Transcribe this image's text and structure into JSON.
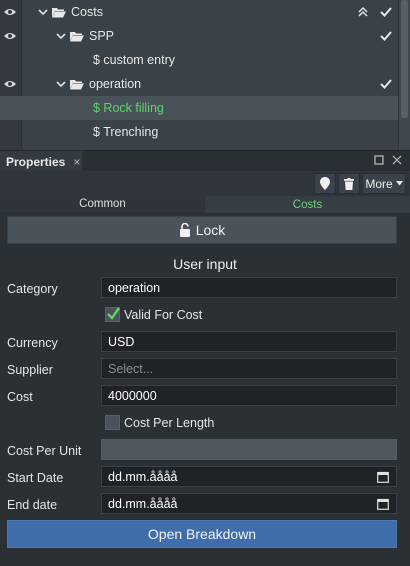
{
  "tree": {
    "rows": [
      {
        "label": "Costs",
        "kind": "folder",
        "expanded": true,
        "eye": true,
        "selected": false,
        "green": false
      },
      {
        "label": "SPP",
        "kind": "folder",
        "expanded": true,
        "eye": true,
        "selected": false,
        "green": false
      },
      {
        "label": "$ custom entry",
        "kind": "leaf",
        "eye": false,
        "selected": false,
        "green": false
      },
      {
        "label": "operation",
        "kind": "folder",
        "expanded": true,
        "eye": true,
        "selected": false,
        "green": false
      },
      {
        "label": "$ Rock filling",
        "kind": "leaf",
        "eye": false,
        "selected": true,
        "green": true
      },
      {
        "label": "$ Trenching",
        "kind": "leaf",
        "eye": false,
        "selected": false,
        "green": false
      }
    ]
  },
  "panel": {
    "tab_label": "Properties",
    "close_glyph": "×",
    "more_label": "More"
  },
  "tabs": {
    "common": "Common",
    "costs": "Costs"
  },
  "lock_label": "Lock",
  "section_title": "User input",
  "form": {
    "category_label": "Category",
    "category_value": "operation",
    "valid_for_cost_label": "Valid For Cost",
    "currency_label": "Currency",
    "currency_value": "USD",
    "supplier_label": "Supplier",
    "supplier_placeholder": "Select...",
    "cost_label": "Cost",
    "cost_value": "4000000",
    "cost_per_length_label": "Cost Per Length",
    "cost_per_unit_label": "Cost Per Unit",
    "start_date_label": "Start Date",
    "start_date_value": "dd.mm.åååå",
    "end_date_label": "End date",
    "end_date_value": "dd.mm.åååå"
  },
  "open_breakdown_label": "Open Breakdown",
  "colors": {
    "accent_green": "#5fd46a",
    "button_blue": "#3f6eaa"
  }
}
